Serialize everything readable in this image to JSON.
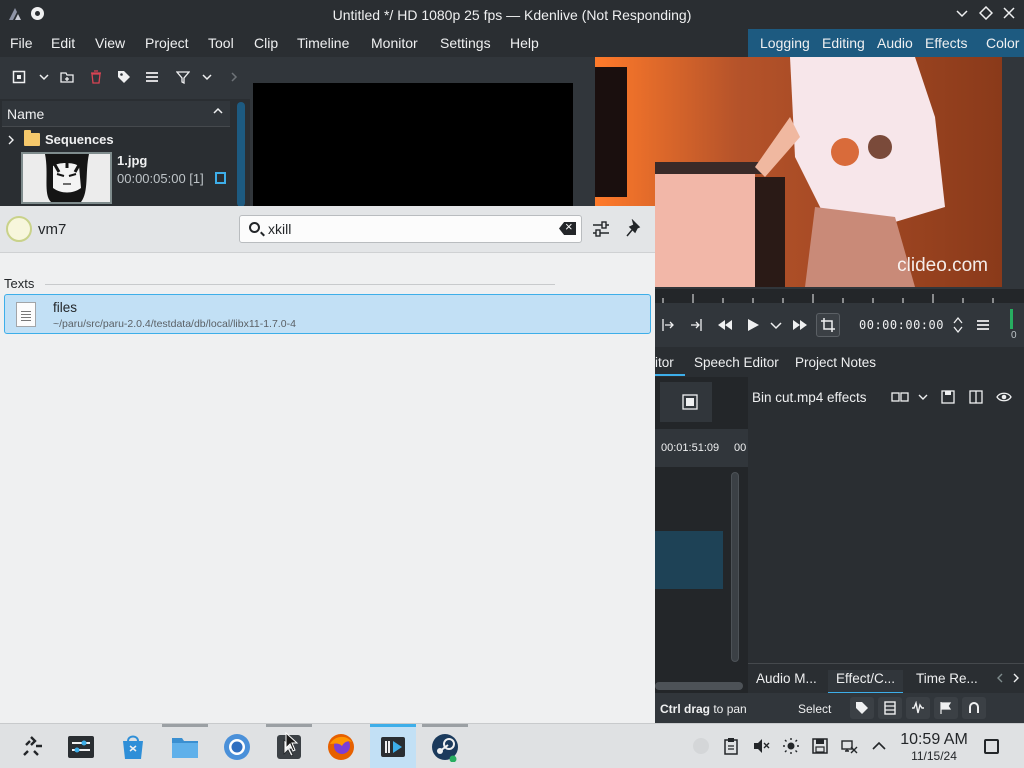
{
  "window": {
    "title": "Untitled */ HD 1080p 25 fps — Kdenlive (Not Responding)",
    "minimize_icon": "chevron-down-icon",
    "maximize_icon": "diamond-icon",
    "close_icon": "close-icon"
  },
  "menu": [
    "File",
    "Edit",
    "View",
    "Project",
    "Tool",
    "Clip",
    "Timeline",
    "Monitor",
    "Settings",
    "Help"
  ],
  "layouts": [
    "Logging",
    "Editing",
    "Audio",
    "Effects",
    "Color"
  ],
  "bin": {
    "header": "Name",
    "folder": "Sequences",
    "clip_name": "1.jpg",
    "clip_duration": "00:00:05:00 [1]"
  },
  "monitor": {
    "watermark": "clideo.com",
    "timecode": "00:00:00:00",
    "level": "0"
  },
  "tabs": [
    "itor",
    "Speech Editor",
    "Project Notes"
  ],
  "timeline": {
    "ruler_ticks": [
      "00:01:51:09",
      "00"
    ]
  },
  "effects": {
    "title": "Bin cut.mp4 effects"
  },
  "bottom_tabs": [
    "Audio M...",
    "Effect/C...",
    "Time Re..."
  ],
  "status": {
    "hint_bold": "Ctrl drag",
    "hint_rest": " to pan",
    "tool": "Select"
  },
  "krunner": {
    "user": "vm7",
    "query": "xkill",
    "section": "Texts",
    "result_title": "files",
    "result_path": "~/paru/src/paru-2.0.4/testdata/db/local/libx11-1.7.0-4"
  },
  "clock": {
    "time": "10:59 AM",
    "date": "11/15/24"
  },
  "colors": {
    "accent": "#3daee9",
    "dark_bg": "#31363b",
    "selection": "#c2e0f5"
  }
}
